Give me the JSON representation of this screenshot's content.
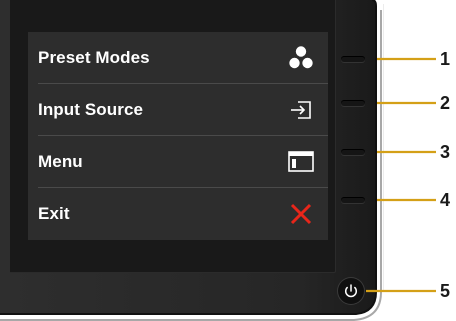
{
  "osd_menu": {
    "items": [
      {
        "label": "Preset Modes",
        "icon": "preset-modes-icon"
      },
      {
        "label": "Input Source",
        "icon": "input-source-icon"
      },
      {
        "label": "Menu",
        "icon": "menu-icon"
      },
      {
        "label": "Exit",
        "icon": "close-icon"
      }
    ]
  },
  "callouts": [
    "1",
    "2",
    "3",
    "4",
    "5"
  ],
  "colors": {
    "callout_line": "#d4a017",
    "exit_icon": "#e8261a",
    "osd_background": "#2d2d2d",
    "screen_background": "#191919",
    "bezel": "#2a2a2a"
  }
}
